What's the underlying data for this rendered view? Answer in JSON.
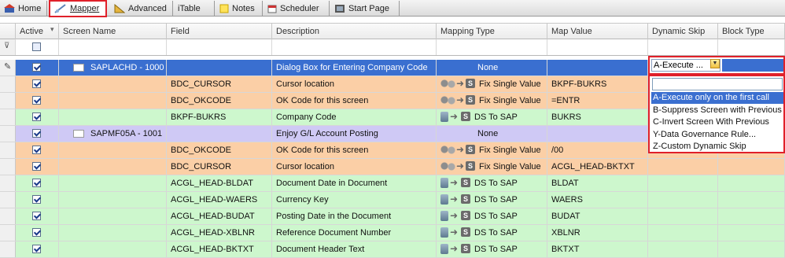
{
  "tabs": [
    {
      "label": "Home",
      "icon": "home-icon"
    },
    {
      "label": "Mapper",
      "icon": "mapper-icon",
      "active": true
    },
    {
      "label": "Advanced",
      "icon": "ruler-icon"
    },
    {
      "label": "iTable",
      "icon": ""
    },
    {
      "label": "Notes",
      "icon": "note-icon"
    },
    {
      "label": "Scheduler",
      "icon": "calendar-icon"
    },
    {
      "label": "Start Page",
      "icon": "start-page-icon"
    }
  ],
  "columns": [
    "Active",
    "Screen Name",
    "Field",
    "Description",
    "Mapping Type",
    "Map Value",
    "Dynamic Skip",
    "Block Type"
  ],
  "rows": [
    {
      "active": true,
      "screen": "SAPLACHD - 1000",
      "field": "",
      "description": "Dialog Box for Entering Company Code",
      "mapping": "None",
      "map_value": "",
      "type": "screen",
      "color": "#3a6fd0",
      "selected": true
    },
    {
      "active": true,
      "screen": "",
      "field": "BDC_CURSOR",
      "description": "Cursor location",
      "mapping": "Fix Single Value",
      "map_value": "BKPF-BUKRS",
      "type": "fix",
      "color": "#fbcfa6"
    },
    {
      "active": true,
      "screen": "",
      "field": "BDC_OKCODE",
      "description": "OK Code for this screen",
      "mapping": "Fix Single Value",
      "map_value": "=ENTR",
      "type": "fix",
      "color": "#fbcfa6"
    },
    {
      "active": true,
      "screen": "",
      "field": "BKPF-BUKRS",
      "description": "Company Code",
      "mapping": "DS To SAP",
      "map_value": "BUKRS",
      "type": "ds",
      "color": "#cdf7cd"
    },
    {
      "active": true,
      "screen": "SAPMF05A - 1001",
      "field": "",
      "description": "Enjoy G/L Account Posting",
      "mapping": "None",
      "map_value": "",
      "type": "screen",
      "color": "#cfc9f5"
    },
    {
      "active": true,
      "screen": "",
      "field": "BDC_OKCODE",
      "description": "OK Code for this screen",
      "mapping": "Fix Single Value",
      "map_value": "/00",
      "type": "fix",
      "color": "#fbcfa6"
    },
    {
      "active": true,
      "screen": "",
      "field": "BDC_CURSOR",
      "description": "Cursor location",
      "mapping": "Fix Single Value",
      "map_value": "ACGL_HEAD-BKTXT",
      "type": "fix",
      "color": "#fbcfa6"
    },
    {
      "active": true,
      "screen": "",
      "field": "ACGL_HEAD-BLDAT",
      "description": "Document Date in Document",
      "mapping": "DS To SAP",
      "map_value": "BLDAT",
      "type": "ds",
      "color": "#cdf7cd"
    },
    {
      "active": true,
      "screen": "",
      "field": "ACGL_HEAD-WAERS",
      "description": "Currency Key",
      "mapping": "DS To SAP",
      "map_value": "WAERS",
      "type": "ds",
      "color": "#cdf7cd"
    },
    {
      "active": true,
      "screen": "",
      "field": "ACGL_HEAD-BUDAT",
      "description": "Posting Date in the Document",
      "mapping": "DS To SAP",
      "map_value": "BUDAT",
      "type": "ds",
      "color": "#cdf7cd"
    },
    {
      "active": true,
      "screen": "",
      "field": "ACGL_HEAD-XBLNR",
      "description": "Reference Document Number",
      "mapping": "DS To SAP",
      "map_value": "XBLNR",
      "type": "ds",
      "color": "#cdf7cd"
    },
    {
      "active": true,
      "screen": "",
      "field": "ACGL_HEAD-BKTXT",
      "description": "Document Header Text",
      "mapping": "DS To SAP",
      "map_value": "BKTXT",
      "type": "ds",
      "color": "#cdf7cd"
    }
  ],
  "dynamic_skip": {
    "selected_value": "A-Execute ...",
    "options": [
      "A-Execute only on the first call",
      "B-Suppress Screen with Previous",
      "C-Invert Screen With Previous",
      "Y-Data Governance Rule...",
      "Z-Custom Dynamic Skip"
    ],
    "highlighted_index": 0
  }
}
